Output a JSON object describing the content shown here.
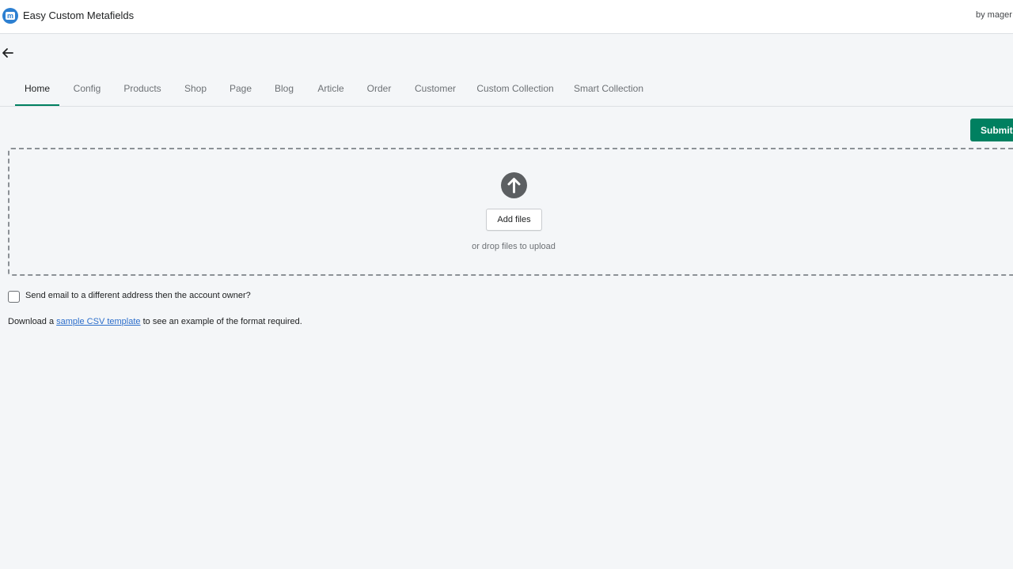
{
  "app": {
    "title": "Easy Custom Metafields",
    "by_text": "by mager",
    "logo_letter": "m",
    "brand_color": "#2c7fd1"
  },
  "nav": {
    "back_icon": "arrow-left-icon",
    "tabs": [
      {
        "label": "Home",
        "active": true
      },
      {
        "label": "Config"
      },
      {
        "label": "Products"
      },
      {
        "label": "Shop"
      },
      {
        "label": "Page"
      },
      {
        "label": "Blog"
      },
      {
        "label": "Article"
      },
      {
        "label": "Order"
      },
      {
        "label": "Customer"
      },
      {
        "label": "Custom Collection"
      },
      {
        "label": "Smart Collection"
      }
    ],
    "active_color": "#008060"
  },
  "actions": {
    "submit_label": "Submit",
    "submit_color": "#008060"
  },
  "dropzone": {
    "icon": "upload-arrow-icon",
    "add_files_label": "Add files",
    "hint": "or drop files to upload"
  },
  "options": {
    "email_checkbox_label": "Send email to a different address then the account owner?",
    "email_checkbox_checked": false
  },
  "download": {
    "prefix": "Download a ",
    "link_text": "sample CSV template",
    "suffix": " to see an example of the format required."
  }
}
